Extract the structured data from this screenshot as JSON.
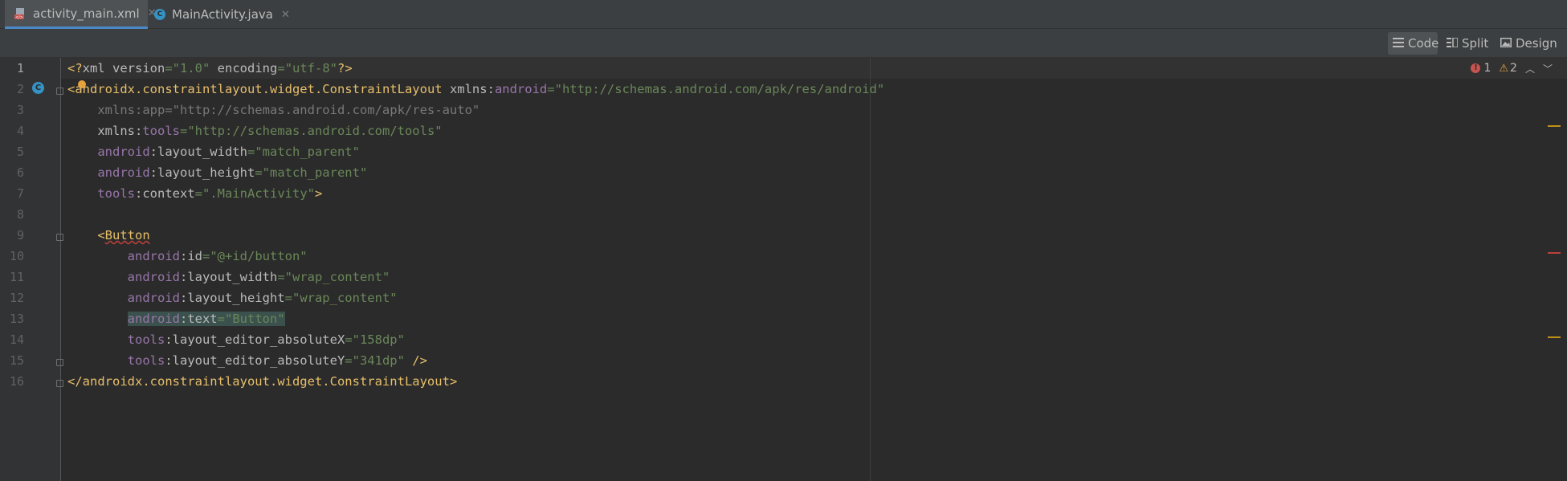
{
  "tabs": [
    {
      "label": "activity_main.xml",
      "icon": "xml-file-icon",
      "active": true
    },
    {
      "label": "MainActivity.java",
      "icon": "java-class-icon",
      "active": false
    }
  ],
  "view_modes": {
    "code": "Code",
    "split": "Split",
    "design": "Design",
    "selected": "Code"
  },
  "inspections": {
    "errors": "1",
    "warnings": "2"
  },
  "line_numbers": [
    "1",
    "2",
    "3",
    "4",
    "5",
    "6",
    "7",
    "8",
    "9",
    "10",
    "11",
    "12",
    "13",
    "14",
    "15",
    "16"
  ],
  "code": {
    "l1": {
      "a": "<?",
      "b": "xml version",
      "c": "=",
      "d": "\"1.0\"",
      "e": " encoding",
      "f": "=",
      "g": "\"utf-8\"",
      "h": "?>"
    },
    "l2": {
      "a": "<",
      "b": "androidx.constraintlayout.widget.ConstraintLayout",
      "c": " xmlns:",
      "d": "android",
      "e": "=",
      "f": "\"http://schemas.android.com/apk/res/android\""
    },
    "l3": {
      "a": "    xmlns:app=\"http://schemas.android.com/apk/res-auto\""
    },
    "l4": {
      "a": "    xmlns:",
      "b": "tools",
      "c": "=",
      "d": "\"http://schemas.android.com/tools\""
    },
    "l5": {
      "a": "    ",
      "b": "android",
      "c": ":layout_width",
      "d": "=",
      "e": "\"match_parent\""
    },
    "l6": {
      "a": "    ",
      "b": "android",
      "c": ":layout_height",
      "d": "=",
      "e": "\"match_parent\""
    },
    "l7": {
      "a": "    ",
      "b": "tools",
      "c": ":context",
      "d": "=",
      "e": "\".MainActivity\"",
      "f": ">"
    },
    "l9": {
      "a": "    <",
      "b": "Button"
    },
    "l10": {
      "a": "        ",
      "b": "android",
      "c": ":id",
      "d": "=",
      "e": "\"@+id/button\""
    },
    "l11": {
      "a": "        ",
      "b": "android",
      "c": ":layout_width",
      "d": "=",
      "e": "\"wrap_content\""
    },
    "l12": {
      "a": "        ",
      "b": "android",
      "c": ":layout_height",
      "d": "=",
      "e": "\"wrap_content\""
    },
    "l13": {
      "a": "        ",
      "b": "android",
      "c": ":text",
      "d": "=",
      "e": "\"Button\""
    },
    "l14": {
      "a": "        ",
      "b": "tools",
      "c": ":layout_editor_absoluteX",
      "d": "=",
      "e": "\"158dp\""
    },
    "l15": {
      "a": "        ",
      "b": "tools",
      "c": ":layout_editor_absoluteY",
      "d": "=",
      "e": "\"341dp\"",
      "f": " />"
    },
    "l16": {
      "a": "</",
      "b": "androidx.constraintlayout.widget.ConstraintLayout",
      "c": ">"
    }
  },
  "colors": {
    "accent": "#4a88c7",
    "tag": "#e8bf6a",
    "namespace": "#9876aa",
    "string": "#6a8759",
    "error": "#bc3f3c",
    "warning": "#be9117"
  }
}
